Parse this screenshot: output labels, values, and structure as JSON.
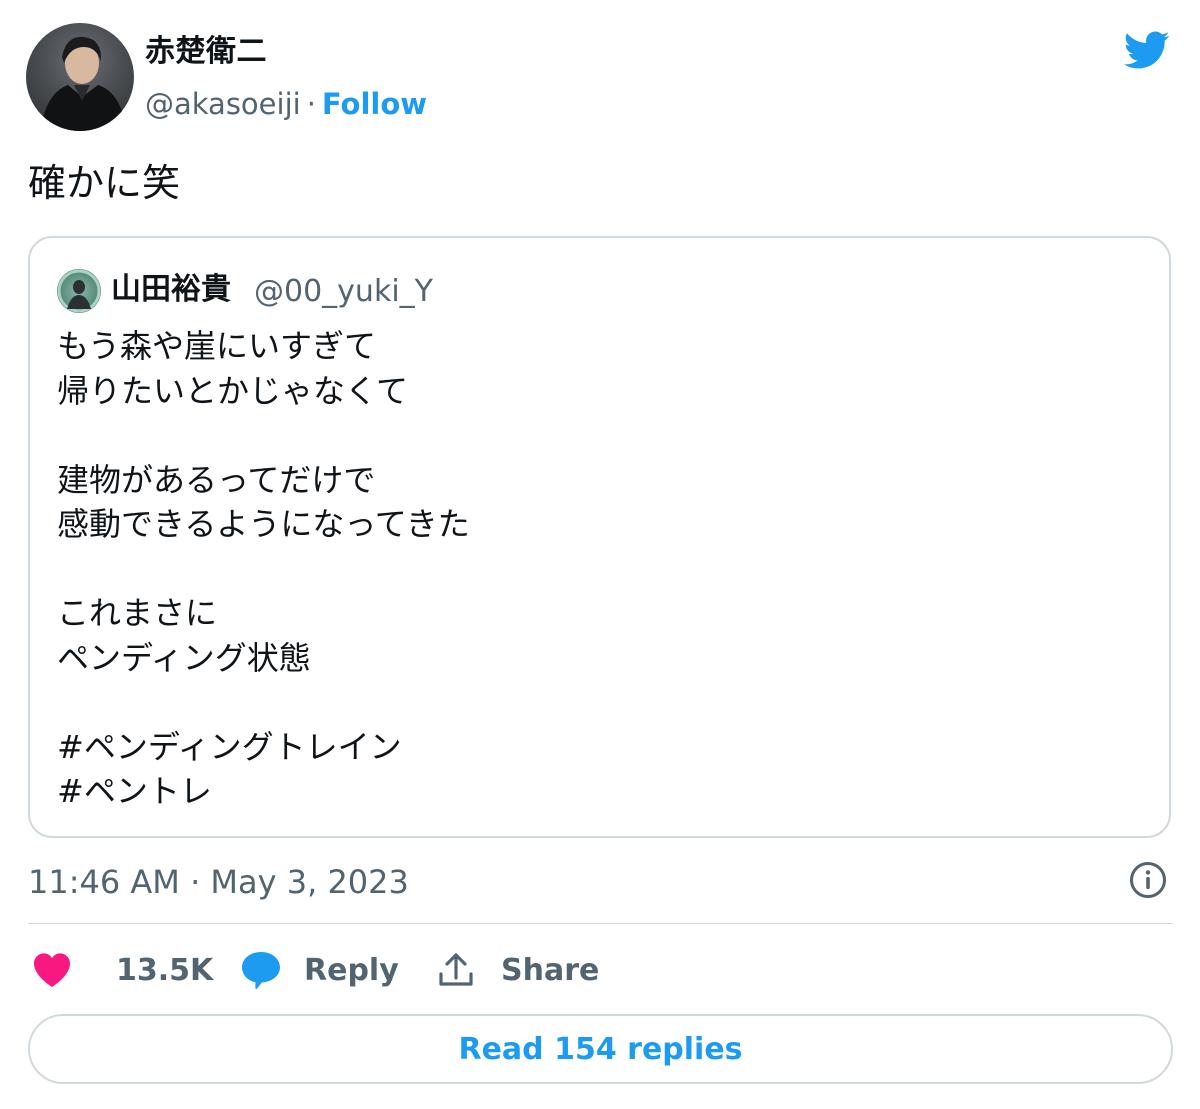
{
  "author": {
    "display_name": "赤楚衛二",
    "handle": "@akasoeiji",
    "separator": "·",
    "follow_label": "Follow"
  },
  "tweet": {
    "text": "確かに笑",
    "timestamp": "11:46 AM · May 3, 2023"
  },
  "quoted_tweet": {
    "display_name": "山田裕貴",
    "handle": "@00_yuki_Y",
    "text": "もう森や崖にいすぎて\n帰りたいとかじゃなくて\n\n建物があるってだけで\n感動できるようになってきた\n\nこれまさに\nペンディング状態\n\n#ペンディングトレイン\n#ペントレ"
  },
  "actions": {
    "like_count": "13.5K",
    "reply_label": "Reply",
    "share_label": "Share",
    "read_replies_label": "Read 154 replies"
  },
  "colors": {
    "accent": "#1d9bf0",
    "like": "#f91880",
    "muted_text": "#536471",
    "border": "#cfd9de"
  },
  "icons": {
    "brand": "twitter-bird-icon",
    "info": "info-icon",
    "like": "heart-icon",
    "reply": "speech-bubble-icon",
    "share": "upload-icon"
  }
}
